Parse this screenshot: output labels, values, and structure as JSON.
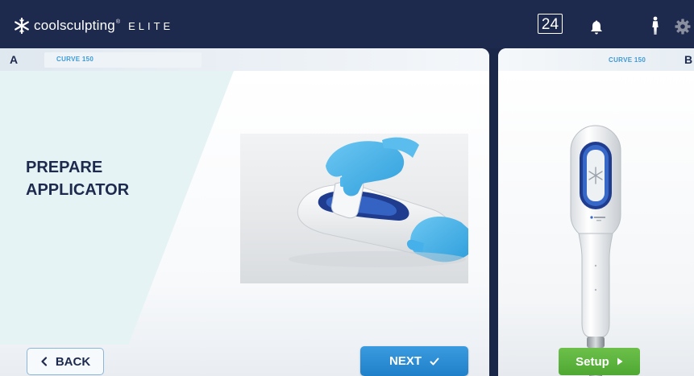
{
  "header": {
    "brand_name": "coolsculpting",
    "brand_tm": "®",
    "brand_edition": "ELITE",
    "counter": "24",
    "icons": [
      "snowflake-logo-icon",
      "bell-icon",
      "person-icon",
      "gear-icon"
    ]
  },
  "panel_a": {
    "label": "A",
    "device": "CURVE 150",
    "step_title_line1": "PREPARE",
    "step_title_line2": "APPLICATOR",
    "back_label": "BACK",
    "next_label": "NEXT"
  },
  "panel_b": {
    "label": "B",
    "device": "CURVE 150",
    "setup_label": "Setup"
  },
  "colors": {
    "navy": "#1d2a4e",
    "accent_blue": "#2a8bd4",
    "setup_green": "#5ab53c",
    "device_blue": "#3d9ad8"
  }
}
